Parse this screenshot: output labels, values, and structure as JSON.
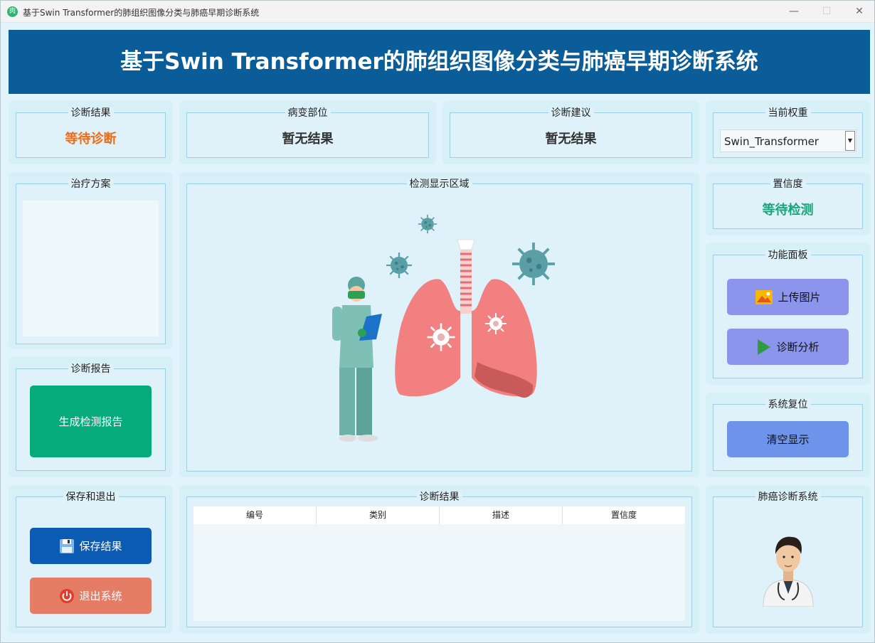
{
  "window": {
    "title": "基于Swin Transformer的肺组织图像分类与肺癌早期诊断系统",
    "app_icon_glyph": "肉"
  },
  "banner": {
    "title": "基于Swin Transformer的肺组织图像分类与肺癌早期诊断系统"
  },
  "diagnosis_result": {
    "label": "诊断结果",
    "value": "等待诊断",
    "color": "#f36a10"
  },
  "lesion_site": {
    "label": "病变部位",
    "value": "暂无结果"
  },
  "diagnosis_advice": {
    "label": "诊断建议",
    "value": "暂无结果"
  },
  "weight": {
    "label": "当前权重",
    "selected": "Swin_Transformer"
  },
  "treatment": {
    "label": "治疗方案",
    "text": ""
  },
  "display": {
    "label": "检测显示区域"
  },
  "confidence": {
    "label": "置信度",
    "value": "等待检测",
    "color": "#17a57a"
  },
  "functions": {
    "label": "功能面板",
    "upload": "上传图片",
    "analyze": "诊断分析"
  },
  "report": {
    "label": "诊断报告",
    "button": "生成检测报告"
  },
  "reset": {
    "label": "系统复位",
    "button": "清空显示"
  },
  "save_exit": {
    "label": "保存和退出",
    "save": "保存结果",
    "exit": "退出系统"
  },
  "results_table": {
    "label": "诊断结果",
    "columns": [
      "编号",
      "类别",
      "描述",
      "置信度"
    ],
    "rows": []
  },
  "brand": {
    "label": "肺癌诊断系统"
  },
  "colors": {
    "banner": "#0a5d98",
    "report_btn": "#05ab7a",
    "save_btn": "#0b5bb3",
    "exit_btn": "#e57c65",
    "function_btn": "#8b95ec",
    "reset_btn": "#6d94ea"
  }
}
